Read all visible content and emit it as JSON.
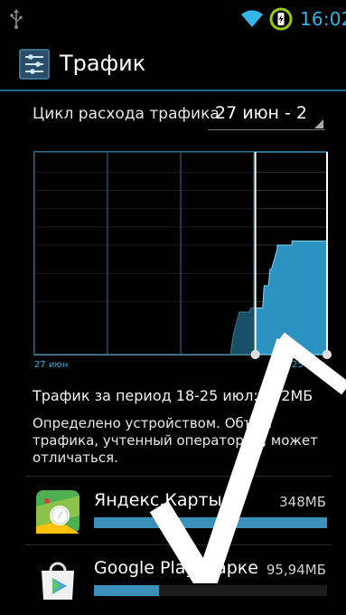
{
  "status_bar": {
    "time": "16:02",
    "icons": [
      "usb-icon",
      "wifi-icon",
      "battery-charging-icon"
    ],
    "accent": "#33b5e5"
  },
  "action_bar": {
    "title": "Трафик",
    "icon": "data-usage-icon"
  },
  "cycle": {
    "label": "Цикл расхода трафика",
    "value": "27 июн - 2"
  },
  "chart_data": {
    "type": "area",
    "x_labels": [
      "27 июн",
      "25 июл"
    ],
    "selection_start_fraction": 0.755,
    "selection_end_fraction": 1.0,
    "series": [
      {
        "values": [
          [
            0.0,
            0
          ],
          [
            0.67,
            0
          ],
          [
            0.68,
            0.1
          ],
          [
            0.7,
            0.21
          ],
          [
            0.735,
            0.21
          ],
          [
            0.74,
            0.23
          ],
          [
            0.78,
            0.23
          ],
          [
            0.785,
            0.34
          ],
          [
            0.8,
            0.34
          ],
          [
            0.805,
            0.42
          ],
          [
            0.81,
            0.42
          ],
          [
            0.83,
            0.52
          ],
          [
            0.83,
            0.54
          ],
          [
            0.88,
            0.54
          ],
          [
            0.88,
            0.56
          ],
          [
            1.0,
            0.56
          ]
        ],
        "color": "#2c93c1"
      }
    ]
  },
  "summary": "Трафик за период 18-25 июл: 472МБ",
  "note": "Определено устройством. Объем трафика, учтенный оператором, может отличаться.",
  "apps": [
    {
      "name": "Яндекс.Карты",
      "size": "348МБ",
      "usage_fraction": 1.0,
      "icon": "yandex-maps-icon"
    },
    {
      "name": "Google Play Марке",
      "size": "95,94МБ",
      "usage_fraction": 0.28,
      "icon": "google-play-icon"
    }
  ],
  "colors": {
    "accent": "#33b5e5",
    "chart_fill": "#2c93c1",
    "bar_fill": "#3a8fbb"
  }
}
